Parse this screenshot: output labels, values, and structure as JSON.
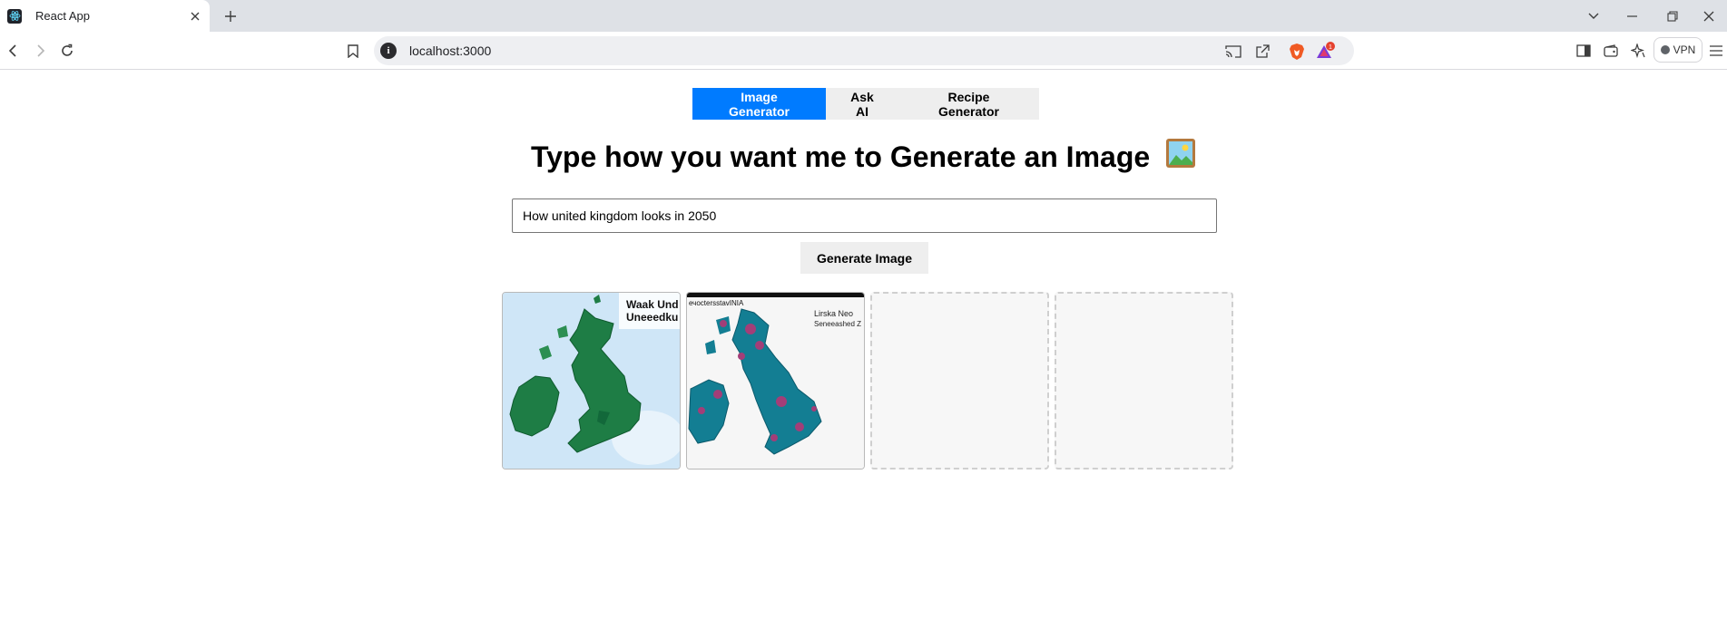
{
  "browser": {
    "tab_title": "React App",
    "url": "localhost:3000",
    "vpn_label": "VPN",
    "alert_count": "1"
  },
  "nav": {
    "items": [
      {
        "label": "Image Generator",
        "active": true
      },
      {
        "label": "Ask AI",
        "active": false
      },
      {
        "label": "Recipe Generator",
        "active": false
      }
    ]
  },
  "main": {
    "heading": "Type how you want me to Generate an Image",
    "heading_icon": "framed-picture-icon",
    "prompt_value": "How united kingdom looks in 2050",
    "generate_label": "Generate Image"
  },
  "images": [
    {
      "state": "generated",
      "caption_line1": "Waak Und",
      "caption_line2": "Uneeedku"
    },
    {
      "state": "generated",
      "top_text": "ечoctersstavINIA",
      "caption_line1": "Lirska Neo",
      "caption_line2": "Seneeashed Z"
    },
    {
      "state": "empty"
    },
    {
      "state": "empty"
    }
  ],
  "colors": {
    "accent": "#007bff",
    "button_bg": "#eeeeee",
    "map1_land": "#1e7d45",
    "map1_sea": "#cfe6f7",
    "map2_land": "#137e93",
    "map2_highlight": "#a33e78"
  }
}
